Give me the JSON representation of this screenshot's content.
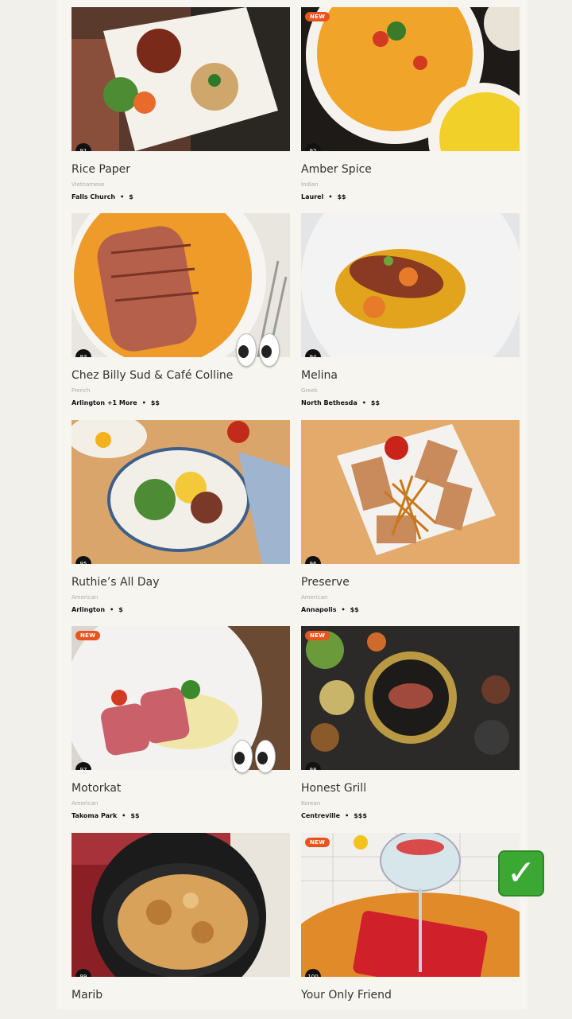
{
  "restaurants": [
    {
      "number": "91",
      "name": "Rice Paper",
      "cuisine": "Vietnamese",
      "location": "Falls Church",
      "price": "$",
      "is_new": false
    },
    {
      "number": "92",
      "name": "Amber Spice",
      "cuisine": "Indian",
      "location": "Laurel",
      "price": "$$",
      "is_new": true
    },
    {
      "number": "93",
      "name": "Chez Billy Sud & Café Colline",
      "cuisine": "French",
      "location": "Arlington +1 More",
      "price": "$$",
      "is_new": false
    },
    {
      "number": "94",
      "name": "Melina",
      "cuisine": "Greek",
      "location": "North Bethesda",
      "price": "$$",
      "is_new": false
    },
    {
      "number": "95",
      "name": "Ruthie’s All Day",
      "cuisine": "American",
      "location": "Arlington",
      "price": "$",
      "is_new": false
    },
    {
      "number": "96",
      "name": "Preserve",
      "cuisine": "American",
      "location": "Annapolis",
      "price": "$$",
      "is_new": false
    },
    {
      "number": "97",
      "name": "Motorkat",
      "cuisine": "American",
      "location": "Takoma Park",
      "price": "$$",
      "is_new": true
    },
    {
      "number": "98",
      "name": "Honest Grill",
      "cuisine": "Korean",
      "location": "Centreville",
      "price": "$$$",
      "is_new": true
    },
    {
      "number": "99",
      "name": "Marib",
      "cuisine": "",
      "location": "",
      "price": "",
      "is_new": false
    },
    {
      "number": "100",
      "name": "Your Only Friend",
      "cuisine": "",
      "location": "",
      "price": "",
      "is_new": true
    }
  ],
  "labels": {
    "new_badge": "NEW",
    "separator": "•"
  },
  "overlays": {
    "eyes_1": "eyes-emoji",
    "eyes_2": "eyes-emoji",
    "check": "check-mark-button-emoji",
    "check_glyph": "✓"
  },
  "colors": {
    "badge": "#e8541f",
    "number_circle": "#111111",
    "check_green": "#3aa832"
  }
}
